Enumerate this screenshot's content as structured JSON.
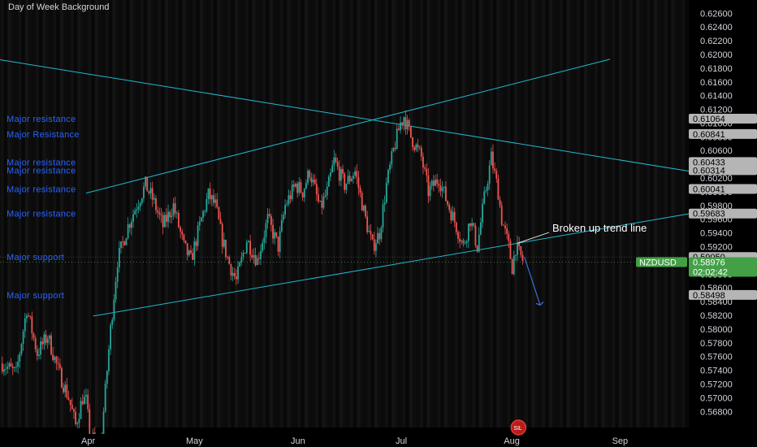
{
  "indicator": {
    "title": "Day of Week Background"
  },
  "colors": {
    "background": "#000000",
    "up_candle": "#26a69a",
    "down_candle": "#ef5350",
    "trendline": "#22b8d0",
    "level_label": "#2962ff",
    "symbol_tag": "#43a047",
    "arrow": "#3d6fd8"
  },
  "chart_data": {
    "type": "candlestick",
    "symbol": "NZDUSD",
    "y_range": [
      0.5665,
      0.6268
    ],
    "y_ticks": [
      "0.62600",
      "0.62400",
      "0.62200",
      "0.62000",
      "0.61800",
      "0.61600",
      "0.61400",
      "0.61200",
      "0.61000",
      "0.60800",
      "0.60600",
      "0.60400",
      "0.60200",
      "0.60000",
      "0.59800",
      "0.59600",
      "0.59400",
      "0.59200",
      "0.59000",
      "0.58800",
      "0.58600",
      "0.58400",
      "0.58200",
      "0.58000",
      "0.57800",
      "0.57600",
      "0.57400",
      "0.57200",
      "0.57000",
      "0.56800"
    ],
    "x_labels": [
      {
        "label": "Apr",
        "bar": 0
      },
      {
        "label": "May",
        "bar": 30
      },
      {
        "label": "Jun",
        "bar": 60
      },
      {
        "label": "Jul",
        "bar": 90
      },
      {
        "label": "Aug",
        "bar": 121
      },
      {
        "label": "Sep",
        "bar": 152
      }
    ],
    "price_path": [
      [
        -24,
        0.575
      ],
      [
        -20,
        0.5735
      ],
      [
        -17,
        0.583
      ],
      [
        -14,
        0.5765
      ],
      [
        -11,
        0.579
      ],
      [
        -8,
        0.574
      ],
      [
        -5,
        0.57
      ],
      [
        -3,
        0.566
      ],
      [
        -1,
        0.57
      ],
      [
        0,
        0.5695
      ],
      [
        1,
        0.565
      ],
      [
        4,
        0.562
      ],
      [
        7,
        0.58
      ],
      [
        9,
        0.59
      ],
      [
        12,
        0.595
      ],
      [
        14,
        0.5975
      ],
      [
        17,
        0.601
      ],
      [
        19,
        0.599
      ],
      [
        22,
        0.595
      ],
      [
        25,
        0.598
      ],
      [
        28,
        0.592
      ],
      [
        30,
        0.59
      ],
      [
        33,
        0.596
      ],
      [
        35,
        0.5995
      ],
      [
        37,
        0.598
      ],
      [
        39,
        0.593
      ],
      [
        41,
        0.5895
      ],
      [
        43,
        0.587
      ],
      [
        46,
        0.593
      ],
      [
        49,
        0.59
      ],
      [
        52,
        0.596
      ],
      [
        55,
        0.592
      ],
      [
        57,
        0.598
      ],
      [
        60,
        0.601
      ],
      [
        62,
        0.6
      ],
      [
        64,
        0.603
      ],
      [
        67,
        0.5975
      ],
      [
        69,
        0.6
      ],
      [
        71,
        0.6045
      ],
      [
        74,
        0.601
      ],
      [
        77,
        0.603
      ],
      [
        80,
        0.596
      ],
      [
        82,
        0.592
      ],
      [
        84,
        0.594
      ],
      [
        86,
        0.601
      ],
      [
        88,
        0.606
      ],
      [
        90,
        0.61
      ],
      [
        91,
        0.611
      ],
      [
        93,
        0.608
      ],
      [
        96,
        0.605
      ],
      [
        98,
        0.6
      ],
      [
        101,
        0.602
      ],
      [
        103,
        0.599
      ],
      [
        106,
        0.595
      ],
      [
        108,
        0.592
      ],
      [
        110,
        0.596
      ],
      [
        112,
        0.592
      ],
      [
        114,
        0.599
      ],
      [
        116,
        0.605
      ],
      [
        118,
        0.6
      ],
      [
        119,
        0.596
      ],
      [
        121,
        0.592
      ],
      [
        122,
        0.589
      ],
      [
        123,
        0.592
      ],
      [
        125,
        0.59
      ]
    ],
    "level_lines": [
      {
        "label": "Major resistance",
        "value": 0.61064,
        "tag": "0.61064"
      },
      {
        "label": "Major Resistance",
        "value": 0.60841,
        "tag": "0.60841"
      },
      {
        "label": "Major resistance",
        "value": 0.60433,
        "tag": "0.60433"
      },
      {
        "label": "Major resistance",
        "value": 0.60314,
        "tag": "0.60314"
      },
      {
        "label": "Major resistance",
        "value": 0.60041,
        "tag": "0.60041"
      },
      {
        "label": "Major resistance",
        "value": 0.59683,
        "tag": "0.59683"
      },
      {
        "label": "Major support",
        "value": 0.5905,
        "tag": "0.59050"
      },
      {
        "label": "Major support",
        "value": 0.58498,
        "tag": "0.58498"
      }
    ],
    "last_price": {
      "symbol": "NZDUSD",
      "value": 0.58976,
      "price_label": "0.58976",
      "countdown": "02:02:42"
    },
    "trendlines": [
      {
        "name": "ascending-channel-upper",
        "from": [
          0,
          0.5998
        ],
        "to": [
          150,
          0.6193
        ]
      },
      {
        "name": "descending-trendline",
        "from": [
          -28,
          0.6195
        ],
        "to": [
          175,
          0.6028
        ]
      },
      {
        "name": "ascending-channel-lower",
        "from": [
          2,
          0.5819
        ],
        "to": [
          175,
          0.597
        ]
      }
    ],
    "annotation": {
      "text": "Broken up trend line",
      "pointer_to": [
        123.5,
        0.5925
      ]
    },
    "projection_arrow": {
      "from": [
        125.5,
        0.5905
      ],
      "to": [
        130,
        0.5835
      ]
    }
  },
  "footer_badge": {
    "text": "SIL"
  }
}
